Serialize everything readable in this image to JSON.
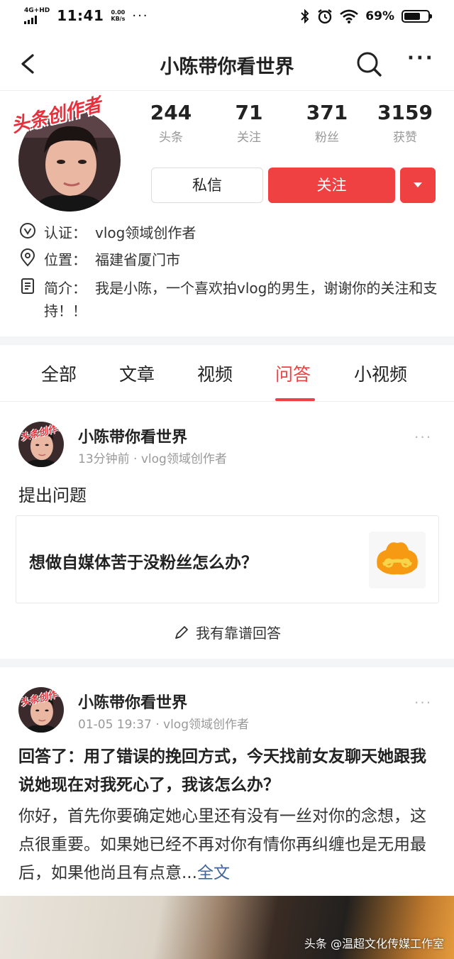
{
  "status_bar": {
    "network": "4G+HD",
    "time": "11:41",
    "speed_value": "0.00",
    "speed_unit": "KB/s",
    "more": "···",
    "battery_text": "69%",
    "battery_level": 0.69
  },
  "nav": {
    "title": "小陈带你看世界",
    "back_icon": "back-arrow-icon",
    "search_icon": "search-icon",
    "more": "···"
  },
  "profile": {
    "badge": "头条创作者",
    "stats": [
      {
        "value": "244",
        "label": "头条"
      },
      {
        "value": "71",
        "label": "关注"
      },
      {
        "value": "371",
        "label": "粉丝"
      },
      {
        "value": "3159",
        "label": "获赞"
      }
    ],
    "message_button": "私信",
    "follow_button": "关注",
    "accent_color": "#f04142",
    "verification_key": "认证：",
    "verification_value": "vlog领域创作者",
    "location_key": "位置：",
    "location_value": "福建省厦门市",
    "bio_key": "简介：",
    "bio_value": "我是小陈，一个喜欢拍vlog的男生，谢谢你的关注和支持！！"
  },
  "tabs": [
    {
      "label": "全部",
      "active": false
    },
    {
      "label": "文章",
      "active": false
    },
    {
      "label": "视频",
      "active": false
    },
    {
      "label": "问答",
      "active": true
    },
    {
      "label": "小视频",
      "active": false
    }
  ],
  "feed": [
    {
      "author": "小陈带你看世界",
      "badge": "头条创作者",
      "meta": "13分钟前 · vlog领域创作者",
      "more": "···",
      "action": "提出问题",
      "question": "想做自媒体苦于没粉丝怎么办？",
      "answer_button": "我有靠谱回答"
    },
    {
      "author": "小陈带你看世界",
      "badge": "头条创作者",
      "meta": "01-05 19:37 · vlog领域创作者",
      "more": "···",
      "answer_title": "回答了：用了错误的挽回方式，今天找前女友聊天她跟我说她现在对我死心了，我该怎么办？",
      "answer_body": "你好，首先你要确定她心里还有没有一丝对你的念想，这点很重要。如果她已经不再对你有情你再纠缠也是无用最后，如果他尚且有点意...",
      "full_text": "全文"
    }
  ],
  "watermark": "头条 @温超文化传媒工作室"
}
